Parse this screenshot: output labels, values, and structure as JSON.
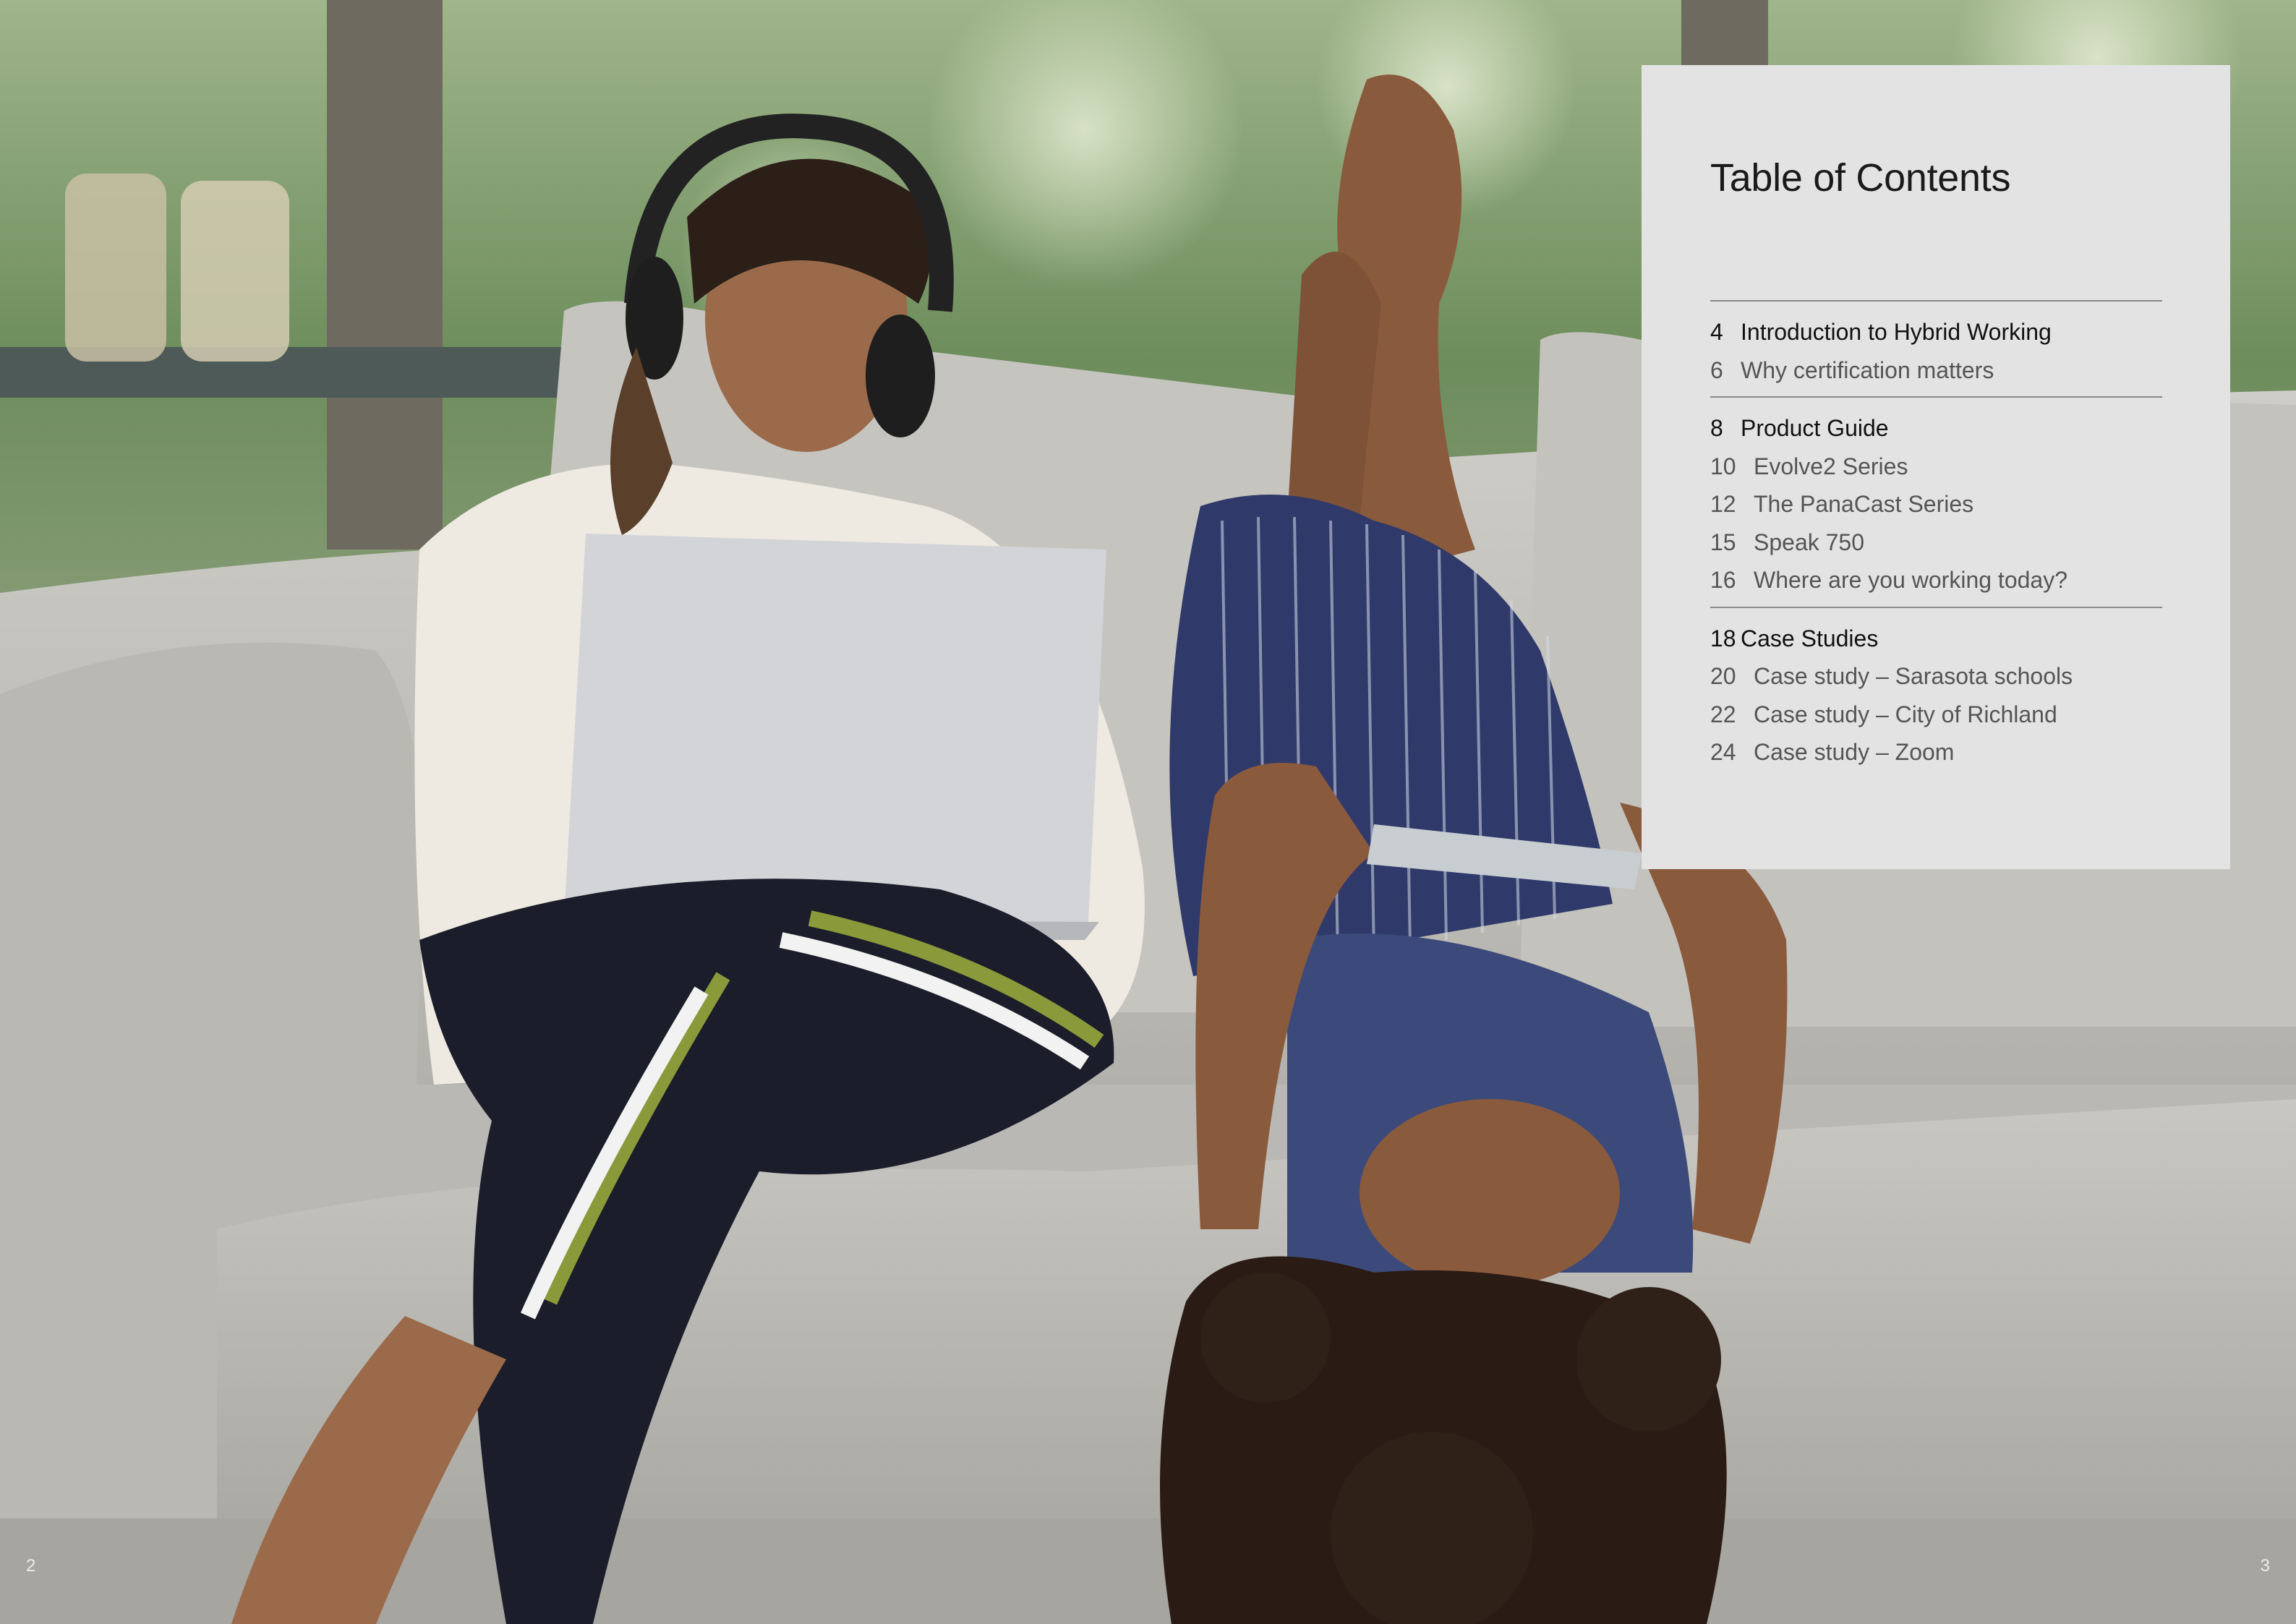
{
  "toc": {
    "title": "Table of Contents",
    "groups": [
      {
        "entries": [
          {
            "page": "4",
            "label": "Introduction to Hybrid Working",
            "level": "major"
          },
          {
            "page": "6",
            "label": "Why certification matters",
            "level": "minor"
          }
        ]
      },
      {
        "entries": [
          {
            "page": "8",
            "label": "Product Guide",
            "level": "major"
          },
          {
            "page": "10",
            "label": "Evolve2 Series",
            "level": "sub"
          },
          {
            "page": "12",
            "label": "The PanaCast Series",
            "level": "sub"
          },
          {
            "page": "15",
            "label": "Speak 750",
            "level": "sub"
          },
          {
            "page": "16",
            "label": "Where are you working today?",
            "level": "sub"
          }
        ]
      },
      {
        "entries": [
          {
            "page": "18",
            "label": "Case Studies",
            "level": "major"
          },
          {
            "page": "20",
            "label": "Case study – Sarasota schools",
            "level": "sub"
          },
          {
            "page": "22",
            "label": "Case study – City of Richland",
            "level": "sub"
          },
          {
            "page": "24",
            "label": "Case study – Zoom",
            "level": "sub"
          }
        ]
      }
    ]
  },
  "page_numbers": {
    "left": "2",
    "right": "3"
  },
  "colors": {
    "panel_background": "#e3e3e3",
    "rule": "#8a8a8a",
    "major_text": "#111111",
    "minor_text": "#555555"
  }
}
